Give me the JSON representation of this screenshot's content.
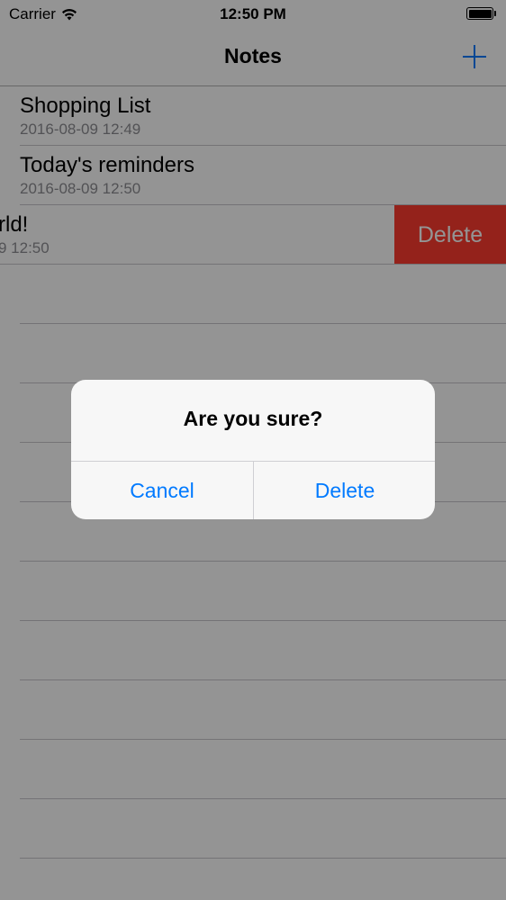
{
  "status_bar": {
    "carrier": "Carrier",
    "time": "12:50 PM",
    "wifi_icon": "wifi-icon",
    "battery_icon": "battery-icon"
  },
  "nav": {
    "title": "Notes",
    "add_icon": "plus-icon"
  },
  "notes": [
    {
      "title": "Shopping List",
      "date": "2016-08-09 12:49"
    },
    {
      "title": "Today's reminders",
      "date": "2016-08-09 12:50"
    },
    {
      "title": "rld!",
      "date": "9 12:50",
      "delete_label": "Delete"
    }
  ],
  "alert": {
    "title": "Are you sure?",
    "cancel_label": "Cancel",
    "delete_label": "Delete"
  },
  "colors": {
    "accent": "#007aff",
    "destructive": "#ff3b30",
    "overlay": "rgba(0,0,0,0.42)"
  }
}
